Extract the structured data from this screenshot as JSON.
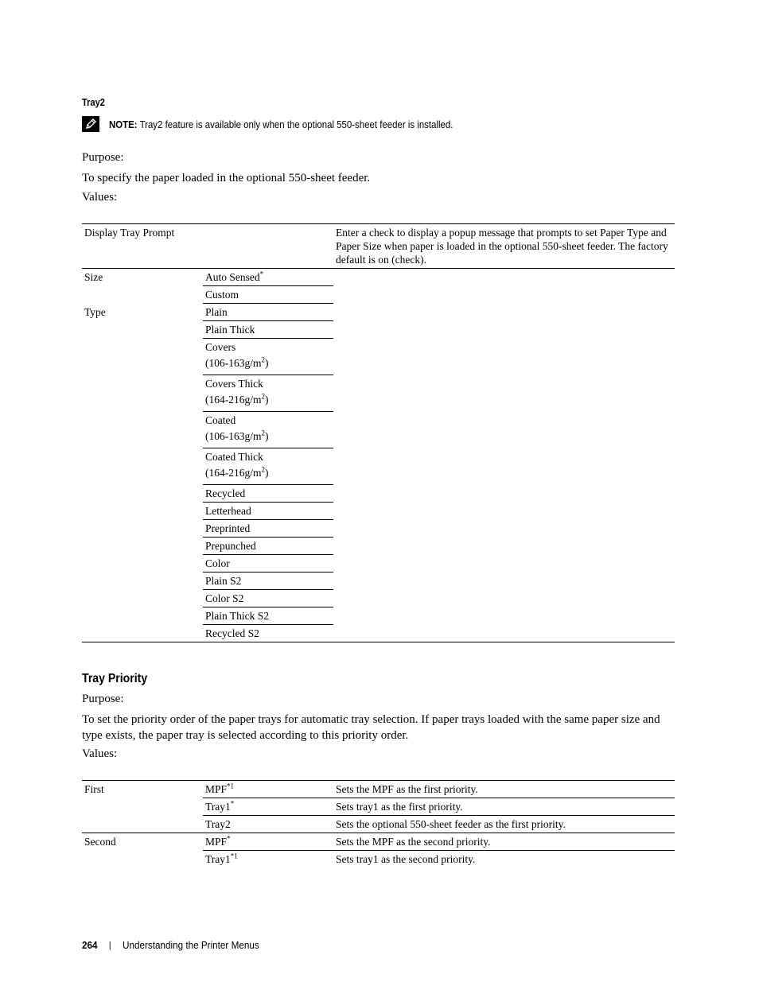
{
  "tray2": {
    "heading": "Tray2",
    "note_icon": "pencil-icon",
    "note_label": "NOTE:",
    "note_text": " Tray2 feature is available only when the optional 550-sheet feeder is installed.",
    "purpose_label": "Purpose:",
    "purpose_text": "To specify the paper loaded in the optional 550-sheet feeder.",
    "values_label": "Values:",
    "table": {
      "display_prompt": {
        "setting": "Display Tray Prompt",
        "description": "Enter a check to display a popup message that prompts to set Paper Type and Paper Size when paper is loaded in the optional 550-sheet feeder. The factory default is on (check)."
      },
      "size": {
        "setting": "Size",
        "options": [
          {
            "label": "Auto Sensed",
            "sup": "*"
          },
          {
            "label": "Custom",
            "sup": ""
          }
        ]
      },
      "type": {
        "setting": "Type",
        "options": [
          {
            "label": "Plain",
            "line2": ""
          },
          {
            "label": "Plain Thick",
            "line2": ""
          },
          {
            "label": "Covers",
            "line2": "(106-163g/m",
            "line2_sup": "2",
            "line2_end": ")"
          },
          {
            "label": "Covers Thick",
            "line2": "(164-216g/m",
            "line2_sup": "2",
            "line2_end": ")"
          },
          {
            "label": "Coated",
            "line2": "(106-163g/m",
            "line2_sup": "2",
            "line2_end": ")"
          },
          {
            "label": "Coated Thick",
            "line2": "(164-216g/m",
            "line2_sup": "2",
            "line2_end": ")"
          },
          {
            "label": "Recycled",
            "line2": ""
          },
          {
            "label": "Letterhead",
            "line2": ""
          },
          {
            "label": "Preprinted",
            "line2": ""
          },
          {
            "label": "Prepunched",
            "line2": ""
          },
          {
            "label": "Color",
            "line2": ""
          },
          {
            "label": "Plain S2",
            "line2": ""
          },
          {
            "label": "Color S2",
            "line2": ""
          },
          {
            "label": "Plain Thick S2",
            "line2": ""
          },
          {
            "label": "Recycled S2",
            "line2": ""
          }
        ]
      }
    }
  },
  "tray_priority": {
    "heading": "Tray Priority",
    "purpose_label": "Purpose:",
    "purpose_text": "To set the priority order of the paper trays for automatic tray selection. If paper trays loaded with the same paper size and type exists, the paper tray is selected according to this priority order.",
    "values_label": "Values:",
    "rows": [
      {
        "group": "First",
        "option": "MPF",
        "sup": "*1",
        "description": "Sets the MPF as the first priority."
      },
      {
        "group": "",
        "option": "Tray1",
        "sup": "*",
        "description": "Sets tray1 as the first priority."
      },
      {
        "group": "",
        "option": "Tray2",
        "sup": "",
        "description": "Sets the optional 550-sheet feeder as the first priority."
      },
      {
        "group": "Second",
        "option": "MPF",
        "sup": "*",
        "description": "Sets the MPF as the second priority."
      },
      {
        "group": "",
        "option": "Tray1",
        "sup": "*1",
        "description": "Sets tray1 as the second priority."
      }
    ]
  },
  "footer": {
    "page_number": "264",
    "separator": "|",
    "chapter": "Understanding the Printer Menus"
  }
}
